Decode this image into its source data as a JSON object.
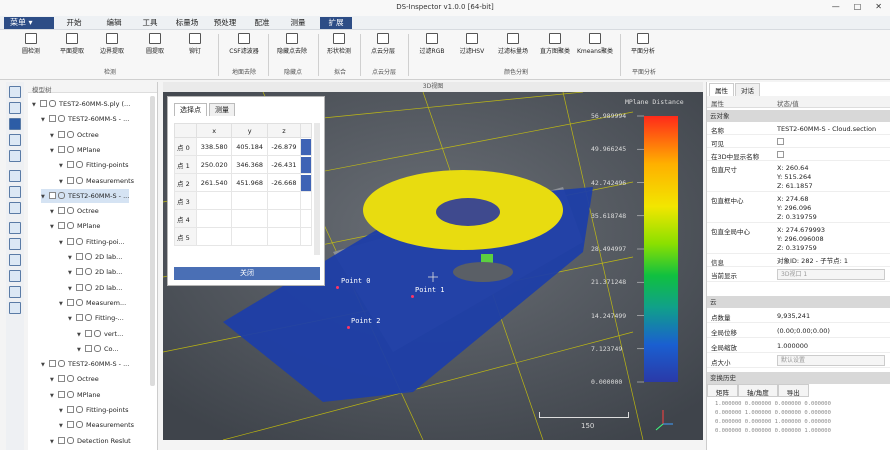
{
  "window": {
    "title": "DS-Inspector v1.0.0 [64-bit]",
    "controls": [
      "—",
      "□",
      "✕"
    ]
  },
  "menu": {
    "app_menu": "菜单 ▾",
    "tabs": [
      "开始",
      "编辑",
      "工具",
      "标量场",
      "预处理",
      "配准",
      "测量",
      "扩展"
    ],
    "active_tab": "扩展"
  },
  "ribbon": {
    "buttons": [
      {
        "label": "圆检测",
        "icon": "circle-detect-icon"
      },
      {
        "label": "平面提取",
        "icon": "plane-extract-icon"
      },
      {
        "label": "边界提取",
        "icon": "boundary-extract-icon"
      },
      {
        "label": "圆提取",
        "icon": "circle-extract-icon"
      },
      {
        "label": "铆钉",
        "icon": "rivet-icon"
      },
      {
        "label": "CSF滤波器",
        "icon": "csf-filter-icon"
      },
      {
        "label": "隐藏点去除",
        "icon": "hidden-point-removal-icon"
      },
      {
        "label": "形状检测",
        "icon": "shape-detect-icon"
      },
      {
        "label": "点云分层",
        "icon": "point-cloud-layer-icon"
      },
      {
        "label": "过滤RGB",
        "icon": "filter-rgb-icon"
      },
      {
        "label": "过滤HSV",
        "icon": "filter-hsv-icon"
      },
      {
        "label": "过滤标量场",
        "icon": "filter-scalar-icon"
      },
      {
        "label": "直方图聚类",
        "icon": "histogram-cluster-icon"
      },
      {
        "label": "Kmeans聚类",
        "icon": "kmeans-icon"
      },
      {
        "label": "平面分析",
        "icon": "plane-analysis-icon"
      }
    ],
    "groups": [
      "检测",
      "地面去除",
      "隐藏点",
      "拟合",
      "点云分层",
      "颜色分割",
      "平面分析"
    ]
  },
  "tree": {
    "header": "模型树",
    "nodes": [
      {
        "label": "TEST2-60MM-S.ply (...",
        "level": 0
      },
      {
        "label": "TEST2-60MM-S - ...",
        "level": 1
      },
      {
        "label": "Octree",
        "level": 2
      },
      {
        "label": "MPlane",
        "level": 2
      },
      {
        "label": "Fitting-points",
        "level": 3
      },
      {
        "label": "Measurements",
        "level": 3
      },
      {
        "label": "TEST2-60MM-S - ...",
        "level": 1
      },
      {
        "label": "Octree",
        "level": 2
      },
      {
        "label": "MPlane",
        "level": 2
      },
      {
        "label": "Fitting-poi...",
        "level": 3
      },
      {
        "label": "2D lab...",
        "level": 4
      },
      {
        "label": "2D lab...",
        "level": 4
      },
      {
        "label": "2D lab...",
        "level": 4
      },
      {
        "label": "Measurem...",
        "level": 3
      },
      {
        "label": "Fitting-...",
        "level": 4
      },
      {
        "label": "vert...",
        "level": 5
      },
      {
        "label": "Co...",
        "level": 5
      },
      {
        "label": "TEST2-60MM-S - ...",
        "level": 1
      },
      {
        "label": "Octree",
        "level": 2
      },
      {
        "label": "MPlane",
        "level": 2
      },
      {
        "label": "Fitting-points",
        "level": 3
      },
      {
        "label": "Measurements",
        "level": 3
      },
      {
        "label": "Detection Reslut",
        "level": 2
      }
    ]
  },
  "viewport": {
    "header": "3D视图"
  },
  "pick_panel": {
    "tabs": [
      "选择点",
      "测量"
    ],
    "columns": [
      "x",
      "y",
      "z"
    ],
    "rows": [
      {
        "label": "点 0",
        "x": "338.580",
        "y": "405.184",
        "z": "-26.879"
      },
      {
        "label": "点 1",
        "x": "250.020",
        "y": "346.368",
        "z": "-26.431"
      },
      {
        "label": "点 2",
        "x": "261.540",
        "y": "451.968",
        "z": "-26.668"
      },
      {
        "label": "点 3",
        "x": "",
        "y": "",
        "z": ""
      },
      {
        "label": "点 4",
        "x": "",
        "y": "",
        "z": ""
      },
      {
        "label": "点 5",
        "x": "",
        "y": "",
        "z": ""
      }
    ],
    "close_label": "关闭"
  },
  "point_labels": [
    "Point 0",
    "Point 1",
    "Point 2"
  ],
  "color_scale": {
    "title": "MPlane Distance",
    "ticks": [
      "56.989994",
      "49.966245",
      "42.742496",
      "35.618748",
      "28.494997",
      "21.371248",
      "14.247499",
      "7.123749",
      "0.000000"
    ],
    "colors": [
      "#ff2a1a",
      "#ffb000",
      "#f2e600",
      "#8be000",
      "#10c040",
      "#10a08a",
      "#1a5fd0",
      "#2a3aa8"
    ]
  },
  "scale_bar": {
    "value": "150"
  },
  "properties": {
    "tabs": [
      "属性",
      "对话"
    ],
    "col_key": "属性",
    "col_val": "状态/值",
    "section_object": "云对象",
    "rows": [
      {
        "key": "名称",
        "val": "TEST2-60MM-S - Cloud.section"
      },
      {
        "key": "可见",
        "val": ""
      },
      {
        "key": "在3D中显示名称",
        "val": ""
      },
      {
        "key": "包直尺寸",
        "val": "X: 260.64\nY: 515.264\nZ: 61.1857"
      },
      {
        "key": "包直框中心",
        "val": "X: 274.68\nY: 296.096\nZ: 0.319759"
      },
      {
        "key": "包直全局中心",
        "val": "X: 274.679993\nY: 296.096008\nZ: 0.319759"
      },
      {
        "key": "信息",
        "val": "对象ID: 282 - 子节点: 1"
      },
      {
        "key": "当前显示",
        "val": "3D视口 1"
      }
    ],
    "section_cloud": "云",
    "cloud_rows": [
      {
        "key": "点数量",
        "val": "9,935,241"
      },
      {
        "key": "全局位移",
        "val": "(0.00;0.00;0.00)"
      },
      {
        "key": "全局缩放",
        "val": "1.000000"
      },
      {
        "key": "点大小",
        "val": "默认设置"
      }
    ],
    "section_history": "变换历史",
    "history_tabs": [
      "矩阵",
      "轴/角度",
      "导出"
    ],
    "history": [
      "1.000000 0.000000 0.000000 0.000000",
      "0.000000 1.000000 0.000000 0.000000",
      "0.000000 0.000000 1.000000 0.000000",
      "0.000000 0.000000 0.000000 1.000000"
    ]
  }
}
